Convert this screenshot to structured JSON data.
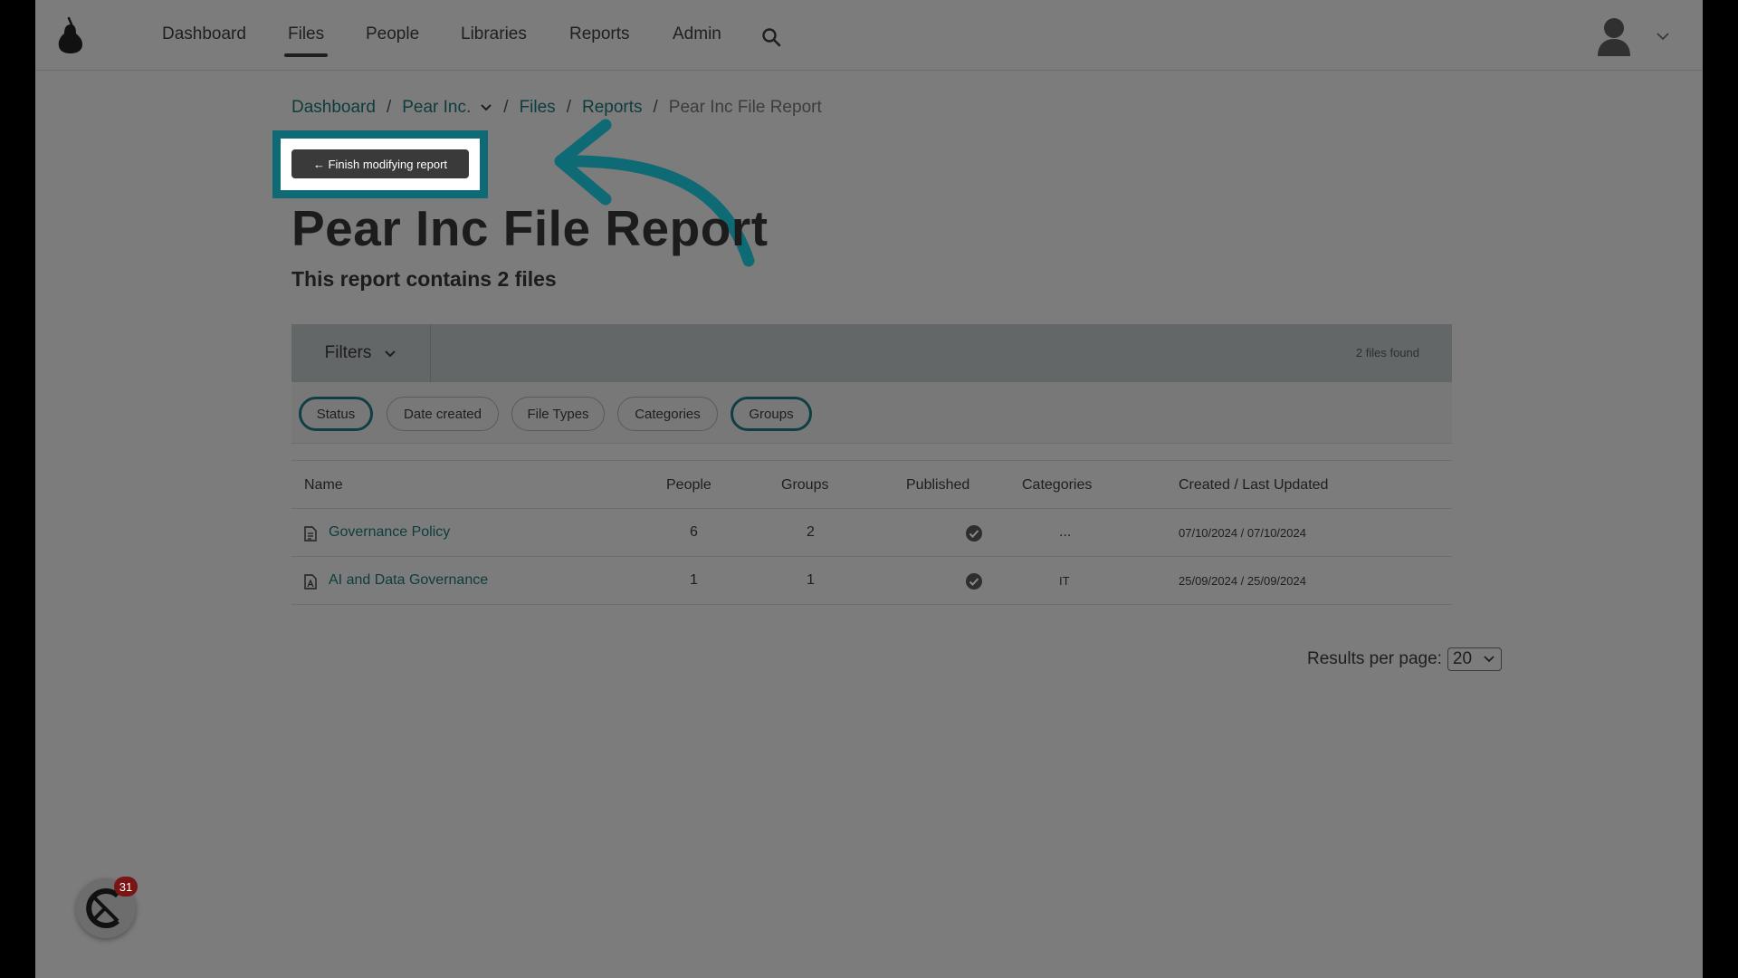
{
  "nav": {
    "items": [
      {
        "label": "Dashboard"
      },
      {
        "label": "Files"
      },
      {
        "label": "People"
      },
      {
        "label": "Libraries"
      },
      {
        "label": "Reports"
      },
      {
        "label": "Admin"
      }
    ],
    "active": "Files"
  },
  "breadcrumb": {
    "items": [
      "Dashboard",
      "Pear Inc.",
      "Files",
      "Reports"
    ],
    "current": "Pear Inc File Report",
    "separator": "/"
  },
  "finish_button": {
    "label": "← Finish modifying report"
  },
  "page": {
    "title": "Pear Inc File Report",
    "subtitle": "This report contains 2 files"
  },
  "filters": {
    "label": "Filters",
    "files_found": "2 files found",
    "chips": [
      {
        "label": "Status",
        "selected": true
      },
      {
        "label": "Date created",
        "selected": false
      },
      {
        "label": "File Types",
        "selected": false
      },
      {
        "label": "Categories",
        "selected": false
      },
      {
        "label": "Groups",
        "selected": true
      }
    ]
  },
  "table": {
    "columns": [
      "Name",
      "People",
      "Groups",
      "Published",
      "Categories",
      "Created / Last Updated"
    ],
    "rows": [
      {
        "name": "Governance Policy",
        "people": "6",
        "groups": "2",
        "published": true,
        "categories": "...",
        "dates": "07/10/2024 / 07/10/2024",
        "icon": "document-icon"
      },
      {
        "name": "AI and Data Governance",
        "people": "1",
        "groups": "1",
        "published": true,
        "categories": "IT",
        "dates": "25/09/2024 / 25/09/2024",
        "icon": "pdf-icon"
      }
    ]
  },
  "pagination": {
    "label": "Results per page:",
    "value": "20"
  },
  "widget": {
    "badge": "31"
  },
  "colors": {
    "accent": "#0e6a74",
    "link": "#0d3c3c",
    "badge": "#7a1515"
  }
}
